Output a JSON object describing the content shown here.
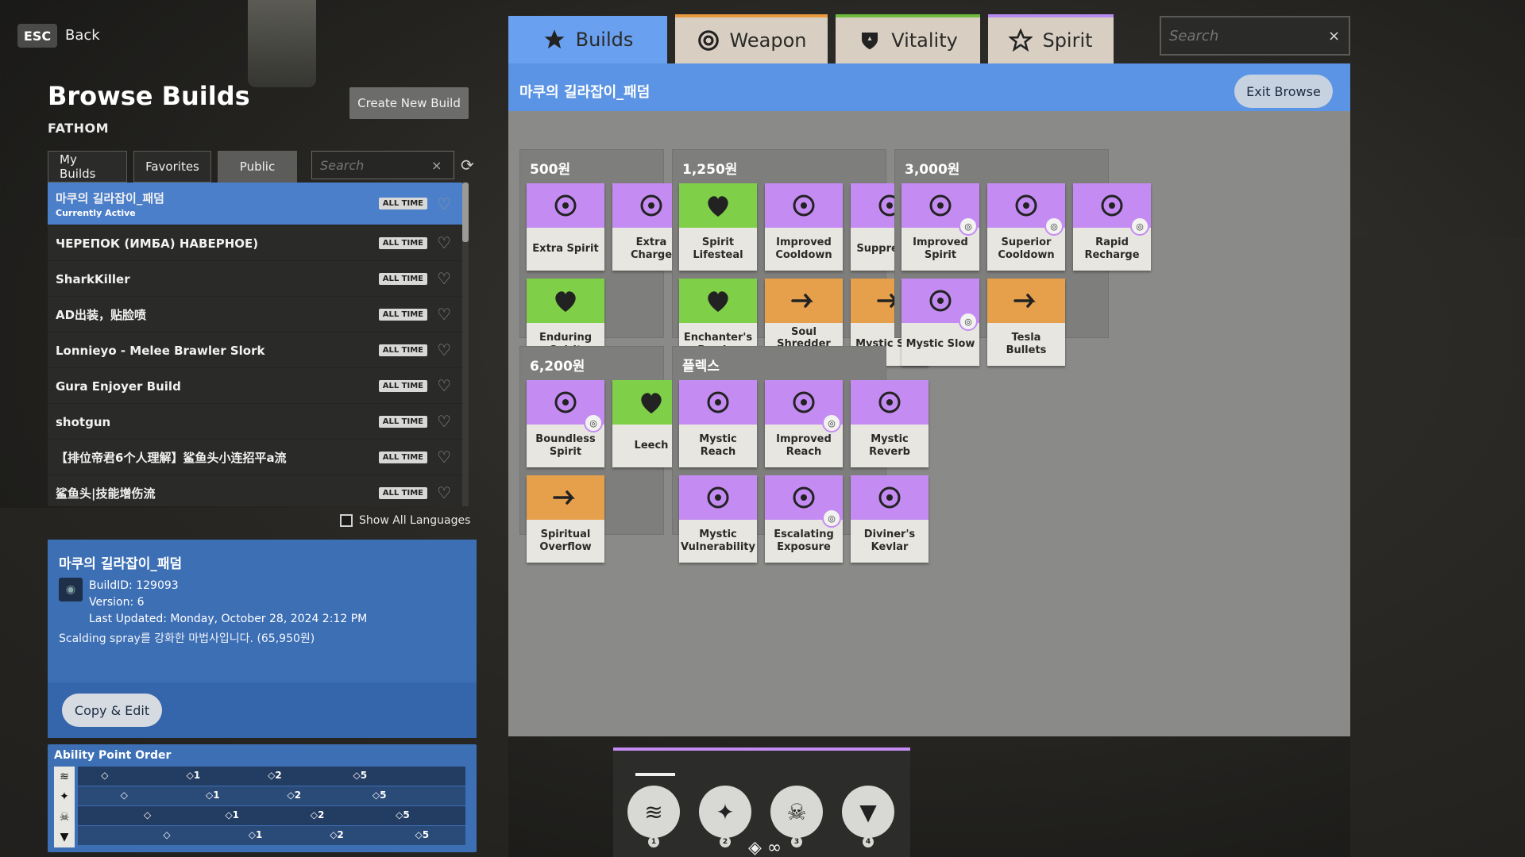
{
  "nav": {
    "esc_key": "ESC",
    "back_label": "Back"
  },
  "left": {
    "title": "Browse Builds",
    "hero": "FATHOM",
    "create_button": "Create New Build",
    "tabs": [
      {
        "label": "My Builds",
        "active": false
      },
      {
        "label": "Favorites",
        "active": false
      },
      {
        "label": "Public",
        "active": true
      }
    ],
    "search_placeholder": "Search",
    "search_clear": "×",
    "builds": [
      {
        "name": "마쿠의 길라잡이_패덤",
        "sub": "Currently Active",
        "badge": "ALL TIME",
        "active": true
      },
      {
        "name": "ЧЕРЕПОК (ИМБА) НАВЕРНОЕ)",
        "badge": "ALL TIME"
      },
      {
        "name": "SharkKiller",
        "badge": "ALL TIME"
      },
      {
        "name": "AD出装，贴脸喷",
        "badge": "ALL TIME"
      },
      {
        "name": "Lonnieyo - Melee Brawler Slork",
        "badge": "ALL TIME"
      },
      {
        "name": "Gura Enjoyer Build",
        "badge": "ALL TIME"
      },
      {
        "name": "shotgun",
        "badge": "ALL TIME"
      },
      {
        "name": "【排位帝君6个人理解】鲨鱼头小连招平a流",
        "badge": "ALL TIME"
      },
      {
        "name": "鲨鱼头|技能增伤流",
        "badge": "ALL TIME"
      }
    ],
    "show_all_languages": "Show All Languages",
    "info": {
      "title": "마쿠의 길라잡이_패덤",
      "build_id": "BuildID: 129093",
      "version": "Version: 6",
      "updated": "Last Updated: Monday, October 28, 2024 2:12 PM",
      "description": "Scalding spray를 강화한 마법사입니다. (65,950원)",
      "copy_button": "Copy & Edit"
    },
    "ability_order": {
      "title": "Ability Point Order",
      "rows": [
        [
          {
            "at": 0.06,
            "t": "◇"
          },
          {
            "at": 0.28,
            "t": "◇1"
          },
          {
            "at": 0.49,
            "t": "◇2"
          },
          {
            "at": 0.71,
            "t": "◇5"
          }
        ],
        [
          {
            "at": 0.11,
            "t": "◇"
          },
          {
            "at": 0.33,
            "t": "◇1"
          },
          {
            "at": 0.54,
            "t": "◇2"
          },
          {
            "at": 0.76,
            "t": "◇5"
          }
        ],
        [
          {
            "at": 0.17,
            "t": "◇"
          },
          {
            "at": 0.38,
            "t": "◇1"
          },
          {
            "at": 0.6,
            "t": "◇2"
          },
          {
            "at": 0.82,
            "t": "◇5"
          }
        ],
        [
          {
            "at": 0.22,
            "t": "◇"
          },
          {
            "at": 0.44,
            "t": "◇1"
          },
          {
            "at": 0.65,
            "t": "◇2"
          },
          {
            "at": 0.87,
            "t": "◇5"
          }
        ]
      ]
    }
  },
  "shop": {
    "tabs": [
      {
        "label": "Builds",
        "icon": "star-icon"
      },
      {
        "label": "Weapon",
        "icon": "weapon-icon"
      },
      {
        "label": "Vitality",
        "icon": "vitality-icon"
      },
      {
        "label": "Spirit",
        "icon": "spirit-icon"
      }
    ],
    "search_placeholder": "Search",
    "search_clear": "×",
    "panel_title": "마쿠의 길라잡이_패덤",
    "exit_button": "Exit Browse",
    "tiers": [
      {
        "label": "500원",
        "items": [
          {
            "name": "Extra Spirit",
            "cat": "spirit"
          },
          {
            "name": "Extra Charge",
            "cat": "spirit"
          },
          {
            "name": "Enduring Spirit",
            "cat": "vital"
          }
        ]
      },
      {
        "label": "1,250원",
        "items": [
          {
            "name": "Spirit Lifesteal",
            "cat": "vital"
          },
          {
            "name": "Improved Cooldown",
            "cat": "spirit"
          },
          {
            "name": "Suppressor",
            "cat": "spirit"
          },
          {
            "name": "Enchanter's Barrier",
            "cat": "vital"
          },
          {
            "name": "Soul Shredder Bullets",
            "cat": "weapon"
          },
          {
            "name": "Mystic Shot",
            "cat": "weapon"
          }
        ]
      },
      {
        "label": "3,000원",
        "items": [
          {
            "name": "Improved Spirit",
            "cat": "spirit",
            "badge": true
          },
          {
            "name": "Superior Cooldown",
            "cat": "spirit",
            "badge": true
          },
          {
            "name": "Rapid Recharge",
            "cat": "spirit",
            "badge": true
          },
          {
            "name": "Mystic Slow",
            "cat": "spirit",
            "badge": true
          },
          {
            "name": "Tesla Bullets",
            "cat": "weapon"
          }
        ]
      },
      {
        "label": "6,200원",
        "items": [
          {
            "name": "Boundless Spirit",
            "cat": "spirit",
            "badge": true
          },
          {
            "name": "Leech",
            "cat": "vital"
          },
          {
            "name": "Spiritual Overflow",
            "cat": "weapon"
          }
        ]
      },
      {
        "label": "플렉스",
        "items": [
          {
            "name": "Mystic Reach",
            "cat": "spirit"
          },
          {
            "name": "Improved Reach",
            "cat": "spirit",
            "badge": true
          },
          {
            "name": "Mystic Reverb",
            "cat": "spirit"
          },
          {
            "name": "Mystic Vulnerability",
            "cat": "spirit"
          },
          {
            "name": "Escalating Exposure",
            "cat": "spirit",
            "badge": true
          },
          {
            "name": "Diviner's Kevlar",
            "cat": "spirit"
          }
        ]
      }
    ]
  },
  "abilities": [
    {
      "num": "1",
      "icon": "wave-icon"
    },
    {
      "num": "2",
      "icon": "claw-icon"
    },
    {
      "num": "3",
      "icon": "skull-icon"
    },
    {
      "num": "4",
      "icon": "shark-jaw-icon"
    }
  ],
  "colors": {
    "spirit": "#c48cf2",
    "vitality": "#7fcf48",
    "weapon": "#e6a04c",
    "accent_blue": "#5b94e4"
  }
}
